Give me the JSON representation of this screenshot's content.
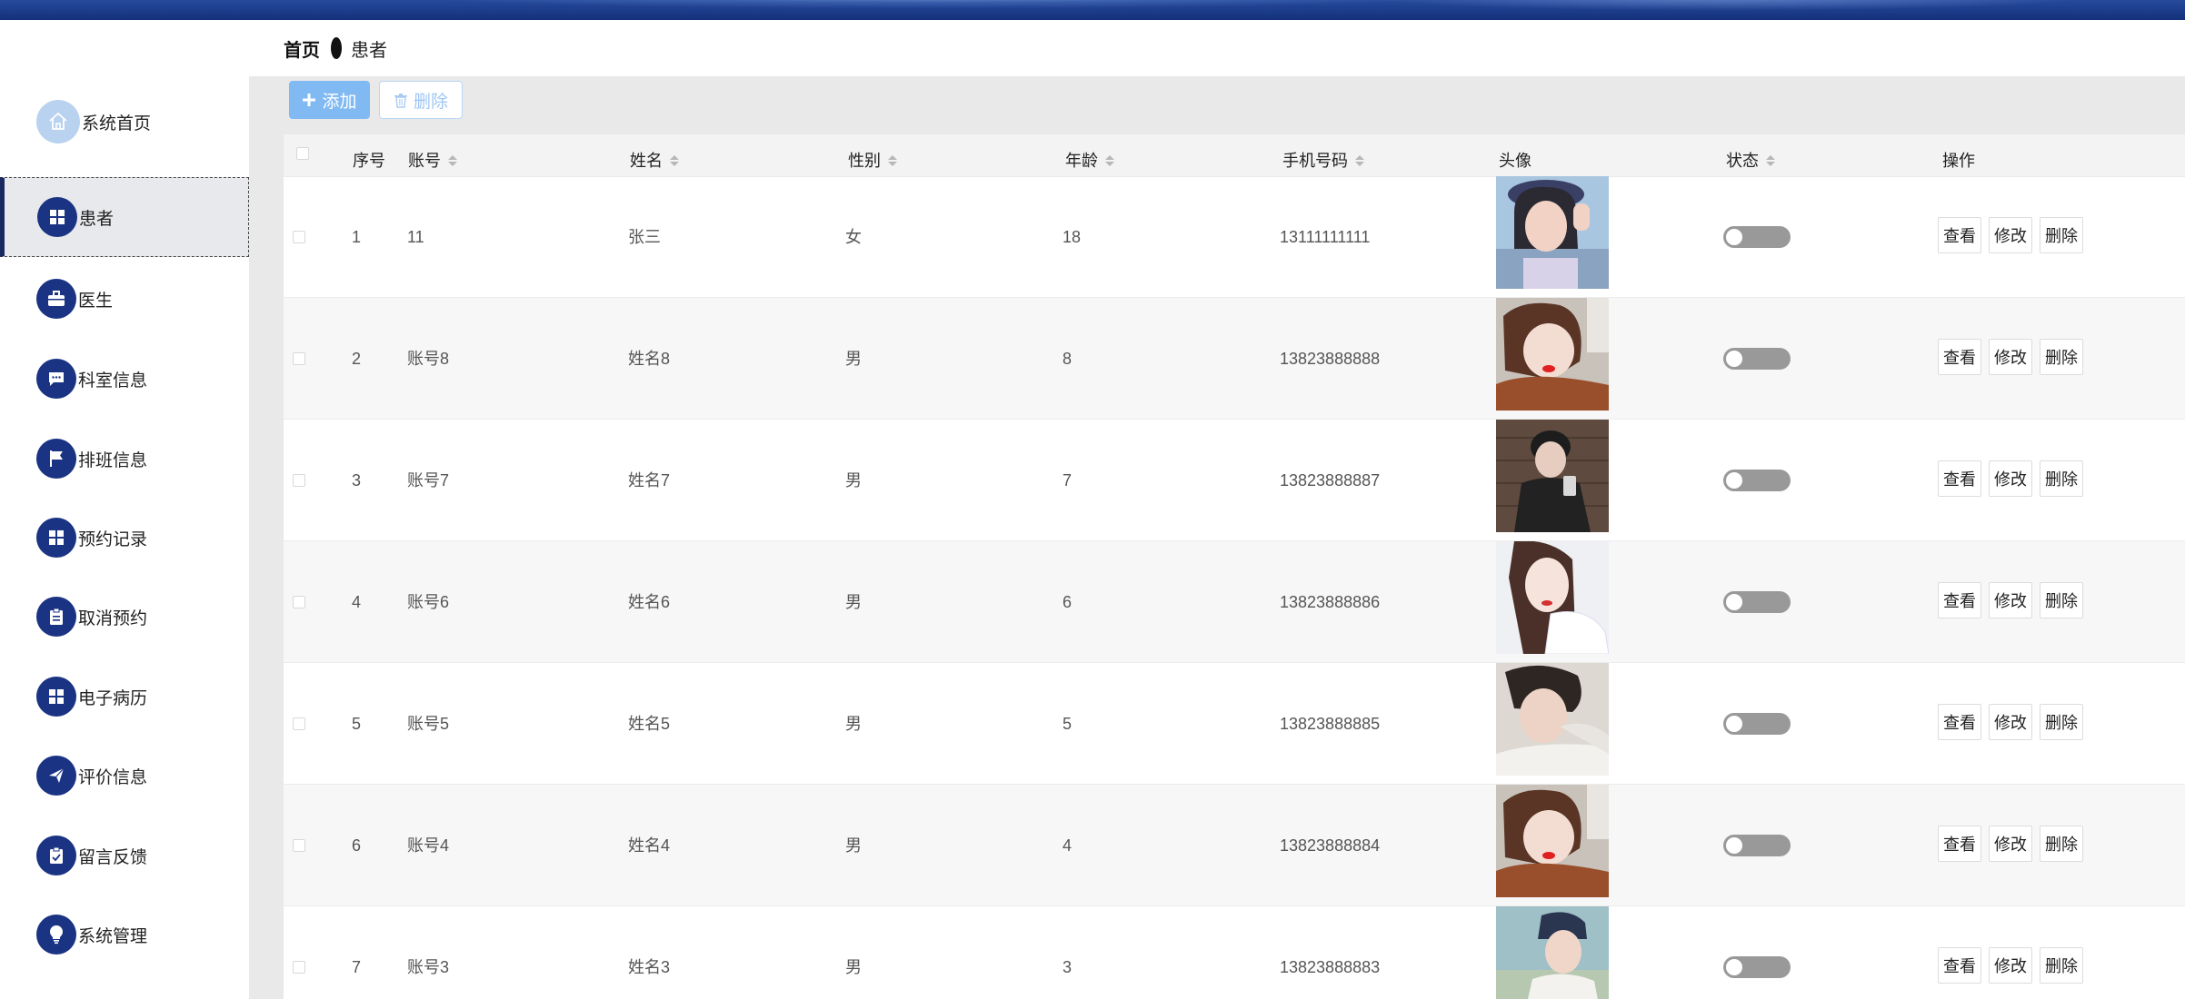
{
  "sidebar": {
    "items": [
      {
        "label": "系统首页",
        "icon": "home-icon"
      },
      {
        "label": "患者",
        "icon": "grid-icon"
      },
      {
        "label": "医生",
        "icon": "briefcase-icon"
      },
      {
        "label": "科室信息",
        "icon": "chat-icon"
      },
      {
        "label": "排班信息",
        "icon": "flag-icon"
      },
      {
        "label": "预约记录",
        "icon": "grid-icon"
      },
      {
        "label": "取消预约",
        "icon": "clipboard-icon"
      },
      {
        "label": "电子病历",
        "icon": "grid-icon"
      },
      {
        "label": "评价信息",
        "icon": "send-icon"
      },
      {
        "label": "留言反馈",
        "icon": "clipboard-check-icon"
      },
      {
        "label": "系统管理",
        "icon": "bulb-icon"
      }
    ],
    "active_index": 1
  },
  "breadcrumb": {
    "home": "首页",
    "current": "患者"
  },
  "toolbar": {
    "add_label": "添加",
    "delete_label": "删除"
  },
  "table": {
    "headers": {
      "index": "序号",
      "account": "账号",
      "name": "姓名",
      "gender": "性别",
      "age": "年龄",
      "phone": "手机号码",
      "avatar": "头像",
      "status": "状态",
      "actions": "操作"
    },
    "action_labels": {
      "view": "查看",
      "edit": "修改",
      "delete": "删除"
    },
    "rows": [
      {
        "index": "1",
        "account": "11",
        "name": "张三",
        "gender": "女",
        "age": "18",
        "phone": "13111111111"
      },
      {
        "index": "2",
        "account": "账号8",
        "name": "姓名8",
        "gender": "男",
        "age": "8",
        "phone": "13823888888"
      },
      {
        "index": "3",
        "account": "账号7",
        "name": "姓名7",
        "gender": "男",
        "age": "7",
        "phone": "13823888887"
      },
      {
        "index": "4",
        "account": "账号6",
        "name": "姓名6",
        "gender": "男",
        "age": "6",
        "phone": "13823888886"
      },
      {
        "index": "5",
        "account": "账号5",
        "name": "姓名5",
        "gender": "男",
        "age": "5",
        "phone": "13823888885"
      },
      {
        "index": "6",
        "account": "账号4",
        "name": "姓名4",
        "gender": "男",
        "age": "4",
        "phone": "13823888884"
      },
      {
        "index": "7",
        "account": "账号3",
        "name": "姓名3",
        "gender": "男",
        "age": "3",
        "phone": "13823888883"
      }
    ]
  },
  "colors": {
    "sidebar_icon_bg": "#1a3383",
    "home_icon_bg": "#b9d2ef",
    "add_button_bg": "#81b9f3",
    "toggle_off": "#999999"
  }
}
